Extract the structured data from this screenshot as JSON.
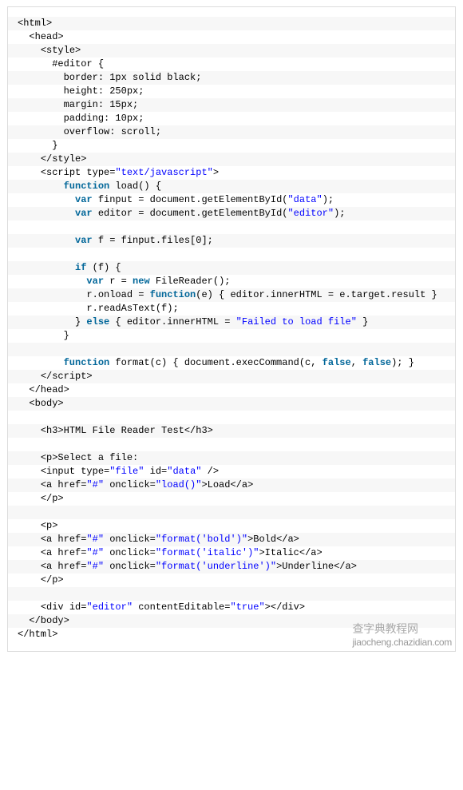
{
  "lines": [
    {
      "indent": 0,
      "parts": [
        {
          "c": "plain",
          "t": "<html>"
        }
      ]
    },
    {
      "indent": 1,
      "parts": [
        {
          "c": "plain",
          "t": "<head>"
        }
      ]
    },
    {
      "indent": 2,
      "parts": [
        {
          "c": "plain",
          "t": "<style>"
        }
      ]
    },
    {
      "indent": 3,
      "parts": [
        {
          "c": "plain",
          "t": "#editor {"
        }
      ]
    },
    {
      "indent": 4,
      "parts": [
        {
          "c": "plain",
          "t": "border: 1px solid black;"
        }
      ]
    },
    {
      "indent": 4,
      "parts": [
        {
          "c": "plain",
          "t": "height: 250px;"
        }
      ]
    },
    {
      "indent": 4,
      "parts": [
        {
          "c": "plain",
          "t": "margin: 15px;"
        }
      ]
    },
    {
      "indent": 4,
      "parts": [
        {
          "c": "plain",
          "t": "padding: 10px;"
        }
      ]
    },
    {
      "indent": 4,
      "parts": [
        {
          "c": "plain",
          "t": "overflow: scroll;"
        }
      ]
    },
    {
      "indent": 3,
      "parts": [
        {
          "c": "plain",
          "t": "}"
        }
      ]
    },
    {
      "indent": 2,
      "parts": [
        {
          "c": "plain",
          "t": "</style>"
        }
      ]
    },
    {
      "indent": 2,
      "parts": [
        {
          "c": "plain",
          "t": "<script type="
        },
        {
          "c": "str",
          "t": "\"text/javascript\""
        },
        {
          "c": "plain",
          "t": ">"
        }
      ]
    },
    {
      "indent": 4,
      "parts": [
        {
          "c": "kw",
          "t": "function"
        },
        {
          "c": "plain",
          "t": " load() {"
        }
      ]
    },
    {
      "indent": 5,
      "parts": [
        {
          "c": "kw",
          "t": "var"
        },
        {
          "c": "plain",
          "t": " finput = document.getElementById("
        },
        {
          "c": "str",
          "t": "\"data\""
        },
        {
          "c": "plain",
          "t": ");"
        }
      ]
    },
    {
      "indent": 5,
      "parts": [
        {
          "c": "kw",
          "t": "var"
        },
        {
          "c": "plain",
          "t": " editor = document.getElementById("
        },
        {
          "c": "str",
          "t": "\"editor\""
        },
        {
          "c": "plain",
          "t": ");"
        }
      ]
    },
    {
      "indent": 0,
      "parts": []
    },
    {
      "indent": 5,
      "parts": [
        {
          "c": "kw",
          "t": "var"
        },
        {
          "c": "plain",
          "t": " f = finput.files[0];"
        }
      ]
    },
    {
      "indent": 0,
      "parts": []
    },
    {
      "indent": 5,
      "parts": [
        {
          "c": "kw",
          "t": "if"
        },
        {
          "c": "plain",
          "t": " (f) {"
        }
      ]
    },
    {
      "indent": 6,
      "parts": [
        {
          "c": "kw",
          "t": "var"
        },
        {
          "c": "plain",
          "t": " r = "
        },
        {
          "c": "kw",
          "t": "new"
        },
        {
          "c": "plain",
          "t": " FileReader();"
        }
      ]
    },
    {
      "indent": 6,
      "parts": [
        {
          "c": "plain",
          "t": "r.onload = "
        },
        {
          "c": "kw",
          "t": "function"
        },
        {
          "c": "plain",
          "t": "(e) { editor.innerHTML = e.target.result }"
        }
      ]
    },
    {
      "indent": 6,
      "parts": [
        {
          "c": "plain",
          "t": "r.readAsText(f);"
        }
      ]
    },
    {
      "indent": 5,
      "parts": [
        {
          "c": "plain",
          "t": "} "
        },
        {
          "c": "kw",
          "t": "else"
        },
        {
          "c": "plain",
          "t": " { editor.innerHTML = "
        },
        {
          "c": "str",
          "t": "\"Failed to load file\""
        },
        {
          "c": "plain",
          "t": " }"
        }
      ]
    },
    {
      "indent": 4,
      "parts": [
        {
          "c": "plain",
          "t": "}"
        }
      ]
    },
    {
      "indent": 0,
      "parts": []
    },
    {
      "indent": 4,
      "parts": [
        {
          "c": "kw",
          "t": "function"
        },
        {
          "c": "plain",
          "t": " format(c) { document.execCommand(c, "
        },
        {
          "c": "kw",
          "t": "false"
        },
        {
          "c": "plain",
          "t": ", "
        },
        {
          "c": "kw",
          "t": "false"
        },
        {
          "c": "plain",
          "t": "); }"
        }
      ]
    },
    {
      "indent": 2,
      "parts": [
        {
          "c": "plain",
          "t": "</script>"
        }
      ]
    },
    {
      "indent": 1,
      "parts": [
        {
          "c": "plain",
          "t": "</head>"
        }
      ]
    },
    {
      "indent": 1,
      "parts": [
        {
          "c": "plain",
          "t": "<body>"
        }
      ]
    },
    {
      "indent": 0,
      "parts": []
    },
    {
      "indent": 2,
      "parts": [
        {
          "c": "plain",
          "t": "<h3>HTML File Reader Test</h3>"
        }
      ]
    },
    {
      "indent": 0,
      "parts": []
    },
    {
      "indent": 2,
      "parts": [
        {
          "c": "plain",
          "t": "<p>Select a file:"
        }
      ]
    },
    {
      "indent": 2,
      "parts": [
        {
          "c": "plain",
          "t": "<input type="
        },
        {
          "c": "str",
          "t": "\"file\""
        },
        {
          "c": "plain",
          "t": " id="
        },
        {
          "c": "str",
          "t": "\"data\""
        },
        {
          "c": "plain",
          "t": " />"
        }
      ]
    },
    {
      "indent": 2,
      "parts": [
        {
          "c": "plain",
          "t": "<a href="
        },
        {
          "c": "str",
          "t": "\"#\""
        },
        {
          "c": "plain",
          "t": " onclick="
        },
        {
          "c": "str",
          "t": "\"load()\""
        },
        {
          "c": "plain",
          "t": ">Load</a>"
        }
      ]
    },
    {
      "indent": 2,
      "parts": [
        {
          "c": "plain",
          "t": "</p>"
        }
      ]
    },
    {
      "indent": 0,
      "parts": []
    },
    {
      "indent": 2,
      "parts": [
        {
          "c": "plain",
          "t": "<p>"
        }
      ]
    },
    {
      "indent": 2,
      "parts": [
        {
          "c": "plain",
          "t": "<a href="
        },
        {
          "c": "str",
          "t": "\"#\""
        },
        {
          "c": "plain",
          "t": " onclick="
        },
        {
          "c": "str",
          "t": "\"format('bold')\""
        },
        {
          "c": "plain",
          "t": ">Bold</a>"
        }
      ]
    },
    {
      "indent": 2,
      "parts": [
        {
          "c": "plain",
          "t": "<a href="
        },
        {
          "c": "str",
          "t": "\"#\""
        },
        {
          "c": "plain",
          "t": " onclick="
        },
        {
          "c": "str",
          "t": "\"format('italic')\""
        },
        {
          "c": "plain",
          "t": ">Italic</a>"
        }
      ]
    },
    {
      "indent": 2,
      "parts": [
        {
          "c": "plain",
          "t": "<a href="
        },
        {
          "c": "str",
          "t": "\"#\""
        },
        {
          "c": "plain",
          "t": " onclick="
        },
        {
          "c": "str",
          "t": "\"format('underline')\""
        },
        {
          "c": "plain",
          "t": ">Underline</a>"
        }
      ]
    },
    {
      "indent": 2,
      "parts": [
        {
          "c": "plain",
          "t": "</p>"
        }
      ]
    },
    {
      "indent": 0,
      "parts": []
    },
    {
      "indent": 2,
      "parts": [
        {
          "c": "plain",
          "t": "<div id="
        },
        {
          "c": "str",
          "t": "\"editor\""
        },
        {
          "c": "plain",
          "t": " contentEditable="
        },
        {
          "c": "str",
          "t": "\"true\""
        },
        {
          "c": "plain",
          "t": "></div>"
        }
      ]
    },
    {
      "indent": 1,
      "parts": [
        {
          "c": "plain",
          "t": "</body>"
        }
      ]
    },
    {
      "indent": 0,
      "parts": [
        {
          "c": "plain",
          "t": "</html>"
        }
      ]
    }
  ],
  "watermark": {
    "cn": "查字典教程网",
    "url": "jiaocheng.chazidian.com"
  }
}
